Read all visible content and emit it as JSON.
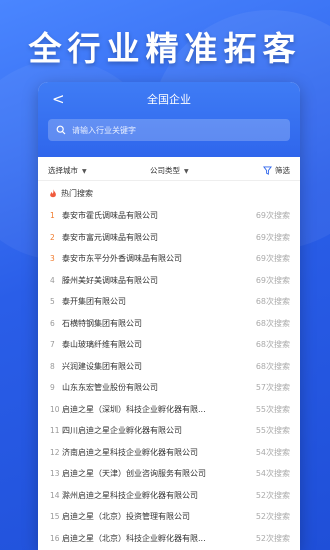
{
  "headline": "全行业精准拓客",
  "app": {
    "title": "全国企业",
    "back_label": "<",
    "search_placeholder": "请输入行业关键字"
  },
  "filters": {
    "city": "选择城市",
    "type": "公司类型",
    "filter": "筛选"
  },
  "hot_title": "热门搜索",
  "items": [
    {
      "rank": "1",
      "name": "泰安市霍氏调味品有限公司",
      "count": "69次搜索"
    },
    {
      "rank": "2",
      "name": "泰安市富元调味品有限公司",
      "count": "69次搜索"
    },
    {
      "rank": "3",
      "name": "泰安市东平分外香调味品有限公司",
      "count": "69次搜索"
    },
    {
      "rank": "4",
      "name": "滕州美好美调味品有限公司",
      "count": "69次搜索"
    },
    {
      "rank": "5",
      "name": "泰开集团有限公司",
      "count": "68次搜索"
    },
    {
      "rank": "6",
      "name": "石横特钢集团有限公司",
      "count": "68次搜索"
    },
    {
      "rank": "7",
      "name": "泰山玻璃纤维有限公司",
      "count": "68次搜索"
    },
    {
      "rank": "8",
      "name": "兴润建设集团有限公司",
      "count": "68次搜索"
    },
    {
      "rank": "9",
      "name": "山东东宏管业股份有限公司",
      "count": "57次搜索"
    },
    {
      "rank": "10",
      "name": "启迪之星（深圳）科技企业孵化器有限...",
      "count": "55次搜索"
    },
    {
      "rank": "11",
      "name": "四川启迪之星企业孵化器有限公司",
      "count": "55次搜索"
    },
    {
      "rank": "12",
      "name": "济南启迪之星科技企业孵化器有限公司",
      "count": "54次搜索"
    },
    {
      "rank": "13",
      "name": "启迪之星（天津）创业咨询服务有限公司",
      "count": "54次搜索"
    },
    {
      "rank": "14",
      "name": "滁州启迪之星科技企业孵化器有限公司",
      "count": "52次搜索"
    },
    {
      "rank": "15",
      "name": "启迪之星（北京）投资管理有限公司",
      "count": "52次搜索"
    },
    {
      "rank": "16",
      "name": "启迪之星（北京）科技企业孵化器有限...",
      "count": "52次搜索"
    }
  ],
  "colors": {
    "accent": "#2f66ec",
    "rank_top": "#f07a2c"
  }
}
